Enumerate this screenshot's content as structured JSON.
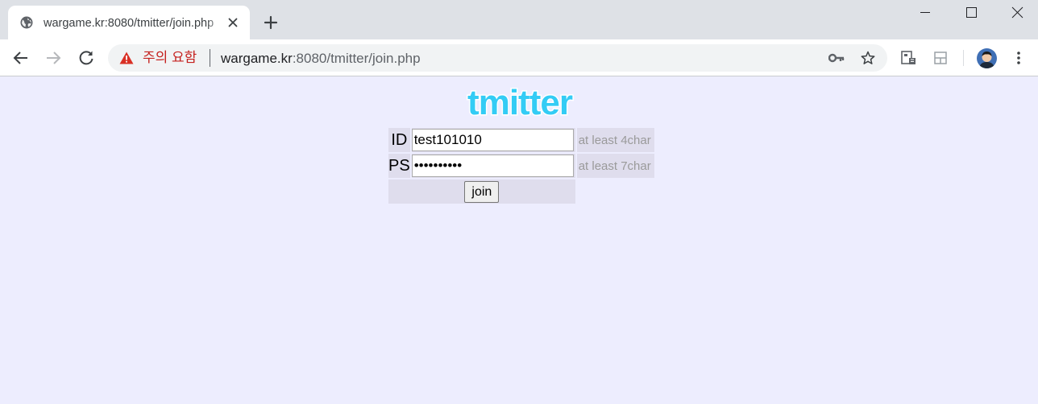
{
  "browser": {
    "tab": {
      "title": "wargame.kr:8080/tmitter/join.php"
    },
    "address_bar": {
      "security_warning": "주의 요함",
      "url_host": "wargame.kr",
      "url_rest": ":8080/tmitter/join.php"
    },
    "icons": {
      "favicon": "globe-icon",
      "tab_close": "close-icon",
      "new_tab": "plus-icon",
      "back": "arrow-left-icon",
      "forward": "arrow-right-icon",
      "reload": "reload-icon",
      "warning": "warning-triangle-icon",
      "key": "key-icon",
      "bookmark": "star-icon",
      "menu": "kebab-menu-icon"
    },
    "colors": {
      "warning": "#c5221f",
      "tab_strip": "#dee1e6"
    }
  },
  "page": {
    "background": "#ededfe",
    "logo_text": "tmitter",
    "form": {
      "id_label": "ID",
      "id_value": "test101010",
      "id_hint": "at least 4char",
      "ps_label": "PS",
      "ps_value": "••••••••••",
      "ps_hint": "at least 7char",
      "submit_label": "join"
    }
  }
}
